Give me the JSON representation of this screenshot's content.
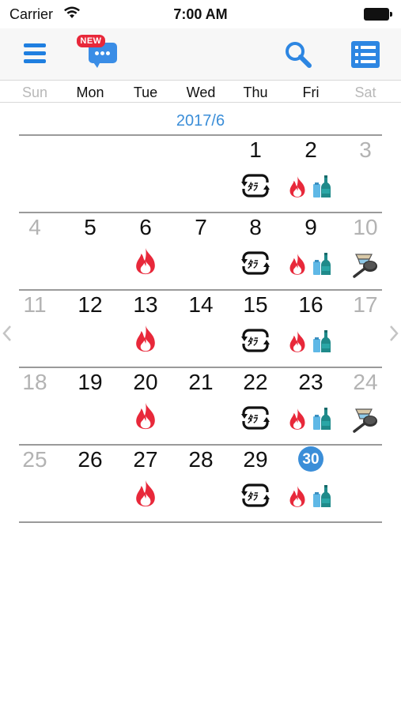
{
  "status_bar": {
    "carrier": "Carrier",
    "time": "7:00 AM"
  },
  "toolbar": {
    "new_badge": "NEW"
  },
  "weekdays": [
    "Sun",
    "Mon",
    "Tue",
    "Wed",
    "Thu",
    "Fri",
    "Sat"
  ],
  "month_title": "2017/6",
  "today": 30,
  "weeks": [
    [
      null,
      null,
      null,
      null,
      {
        "d": "1",
        "icons": [
          "recycle"
        ]
      },
      {
        "d": "2",
        "icons": [
          "burnable",
          "bottles"
        ]
      },
      {
        "d": "3",
        "icons": []
      }
    ],
    [
      {
        "d": "4",
        "icons": []
      },
      {
        "d": "5",
        "icons": []
      },
      {
        "d": "6",
        "icons": [
          "burnable"
        ]
      },
      {
        "d": "7",
        "icons": []
      },
      {
        "d": "8",
        "icons": [
          "recycle"
        ]
      },
      {
        "d": "9",
        "icons": [
          "burnable",
          "bottles"
        ]
      },
      {
        "d": "10",
        "icons": [
          "dishware"
        ]
      }
    ],
    [
      {
        "d": "11",
        "icons": []
      },
      {
        "d": "12",
        "icons": []
      },
      {
        "d": "13",
        "icons": [
          "burnable"
        ]
      },
      {
        "d": "14",
        "icons": []
      },
      {
        "d": "15",
        "icons": [
          "recycle"
        ]
      },
      {
        "d": "16",
        "icons": [
          "burnable",
          "bottles"
        ]
      },
      {
        "d": "17",
        "icons": []
      }
    ],
    [
      {
        "d": "18",
        "icons": []
      },
      {
        "d": "19",
        "icons": []
      },
      {
        "d": "20",
        "icons": [
          "burnable"
        ]
      },
      {
        "d": "21",
        "icons": []
      },
      {
        "d": "22",
        "icons": [
          "recycle"
        ]
      },
      {
        "d": "23",
        "icons": [
          "burnable",
          "bottles"
        ]
      },
      {
        "d": "24",
        "icons": [
          "dishware"
        ]
      }
    ],
    [
      {
        "d": "25",
        "icons": []
      },
      {
        "d": "26",
        "icons": []
      },
      {
        "d": "27",
        "icons": [
          "burnable"
        ]
      },
      {
        "d": "28",
        "icons": []
      },
      {
        "d": "29",
        "icons": [
          "recycle"
        ]
      },
      {
        "d": "30",
        "icons": [
          "burnable",
          "bottles"
        ]
      },
      null
    ]
  ],
  "recycle_icon_label": "ﾀﾗ",
  "colors": {
    "accent": "#3b8ed8",
    "fire": "#e8283a",
    "weekend": "#b3b3b3",
    "badge": "#e8283a"
  }
}
